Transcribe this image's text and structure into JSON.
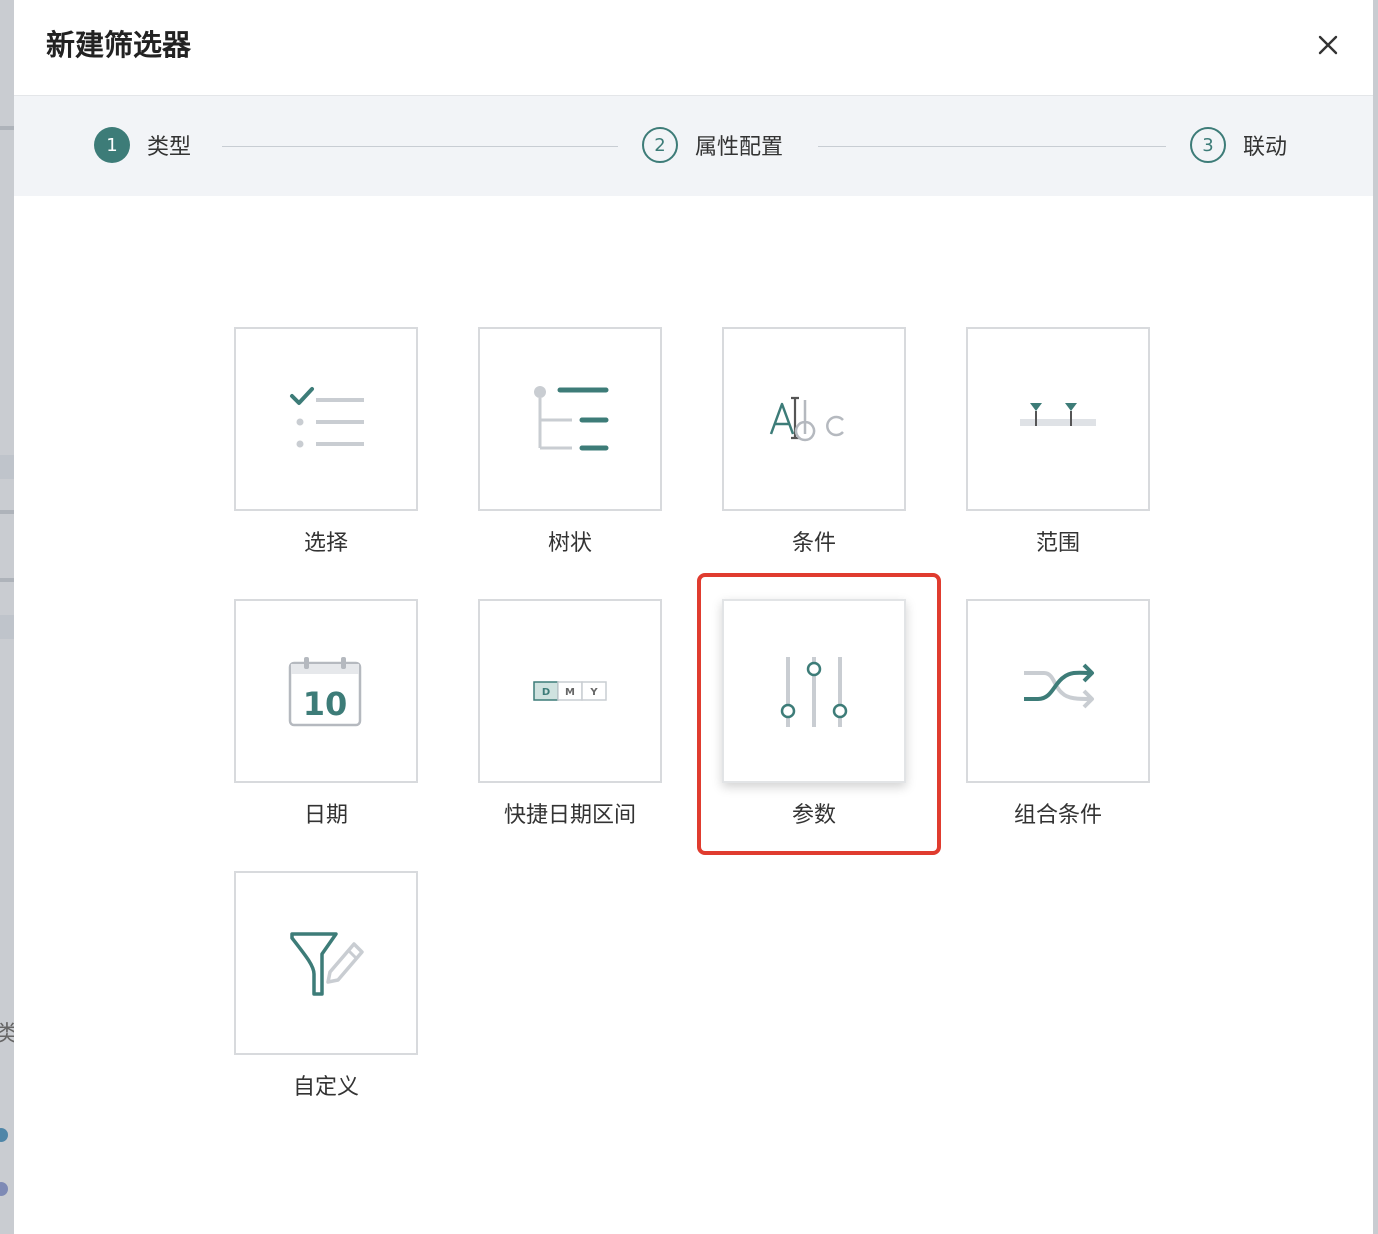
{
  "dialog": {
    "title": "新建筛选器",
    "close_icon": "close-icon"
  },
  "steps": [
    {
      "number": "1",
      "label": "类型",
      "state": "active"
    },
    {
      "number": "2",
      "label": "属性配置",
      "state": "pending"
    },
    {
      "number": "3",
      "label": "联动",
      "state": "pending"
    }
  ],
  "filter_types": [
    {
      "label": "选择",
      "icon": "checklist-icon"
    },
    {
      "label": "树状",
      "icon": "tree-icon"
    },
    {
      "label": "条件",
      "icon": "text-condition-icon",
      "icon_text": "Abc"
    },
    {
      "label": "范围",
      "icon": "range-slider-icon"
    },
    {
      "label": "日期",
      "icon": "calendar-icon",
      "icon_text": "10"
    },
    {
      "label": "快捷日期区间",
      "icon": "date-range-icon",
      "icon_letters": [
        "D",
        "M",
        "Y"
      ]
    },
    {
      "label": "参数",
      "icon": "parameter-sliders-icon",
      "selected": true
    },
    {
      "label": "组合条件",
      "icon": "combine-arrows-icon"
    },
    {
      "label": "自定义",
      "icon": "custom-filter-icon"
    }
  ],
  "colors": {
    "accent": "#3d7c78",
    "highlight": "#e03c2f",
    "step_bar_bg": "#f2f4f7",
    "tile_border": "#d8dadd",
    "icon_gray": "#c9cdd2"
  },
  "background_fragment": "类:"
}
